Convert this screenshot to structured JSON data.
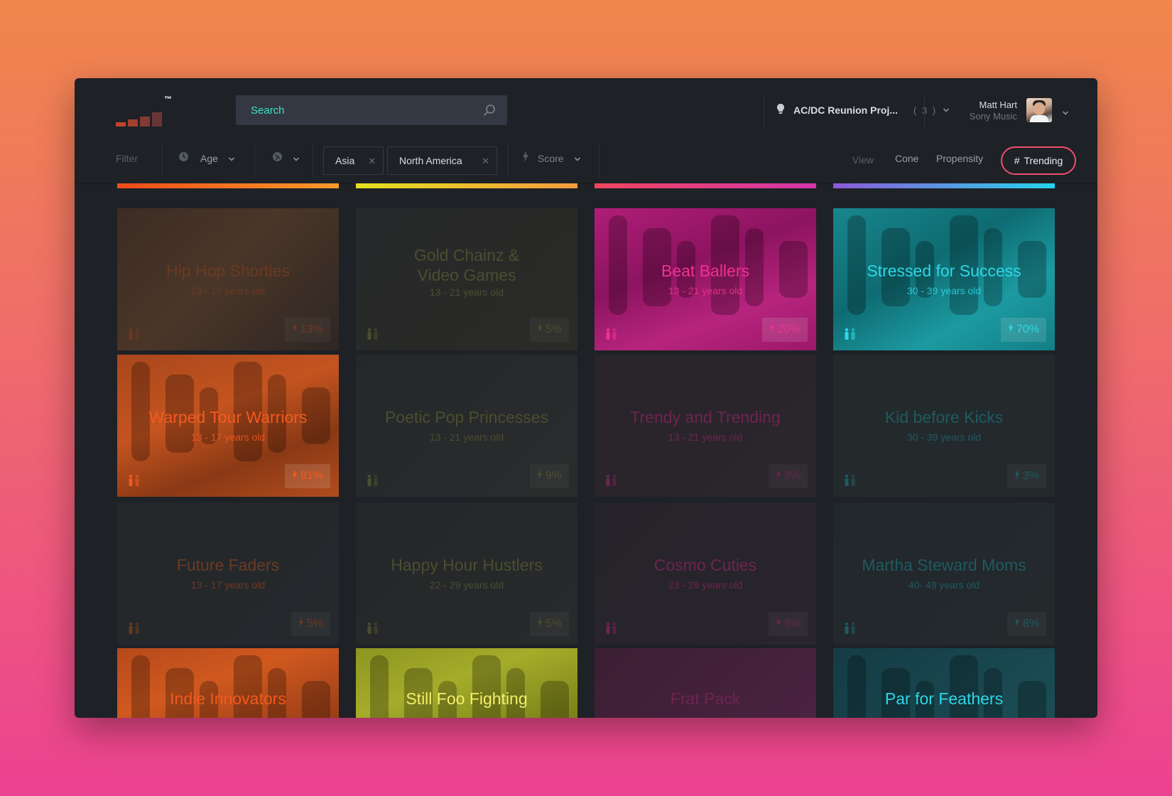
{
  "colors": {
    "orange": "#f25a1f",
    "olive": "#c2c73a",
    "magenta": "#f0318f",
    "cyan": "#2ed7e6",
    "accent_search": "#3fe0c5",
    "trending_ring": "#ef4d6f"
  },
  "header": {
    "search_placeholder": "Search",
    "project_name": "AC/DC Reunion Proj...",
    "project_count": "( 3 )",
    "user_name": "Matt Hart",
    "user_company": "Sony Music"
  },
  "filters": {
    "label": "Filter",
    "age_label": "Age",
    "chips": [
      "Asia",
      "North America"
    ],
    "score_label": "Score",
    "view_label": "View",
    "view_options": [
      "Cone",
      "Propensity"
    ],
    "active_view": "Trending"
  },
  "cards": [
    {
      "title": "Hip Hop Shorties",
      "age": "13 - 17 years old",
      "score": "13%"
    },
    {
      "title": "Gold Chainz & Video Games",
      "age": "13 - 21 years old",
      "score": "5%"
    },
    {
      "title": "Beat Ballers",
      "age": "13 - 21 years old",
      "score": "20%"
    },
    {
      "title": "Stressed for Success",
      "age": "30 - 39 years old",
      "score": "70%"
    },
    {
      "title": "Warped Tour Warriors",
      "age": "13 - 17 years old",
      "score": "81%"
    },
    {
      "title": "Poetic Pop Princesses",
      "age": "13 - 21 years old",
      "score": "9%"
    },
    {
      "title": "Trendy and Trending",
      "age": "13 - 21 years old",
      "score": "3%"
    },
    {
      "title": "Kid before Kicks",
      "age": "30 - 39 years old",
      "score": "3%"
    },
    {
      "title": "Future Faders",
      "age": "13 - 17 years old",
      "score": "5%"
    },
    {
      "title": "Happy Hour Hustlers",
      "age": "22 - 29 years old",
      "score": "5%"
    },
    {
      "title": "Cosmo Cuties",
      "age": "23 - 29 years old",
      "score": "8%"
    },
    {
      "title": "Martha Steward Moms",
      "age": "40- 49 years old",
      "score": "8%"
    },
    {
      "title": "Indie Innovators",
      "age": "",
      "score": ""
    },
    {
      "title": "Still Foo Fighting",
      "age": "",
      "score": ""
    },
    {
      "title": "Frat Pack",
      "age": "",
      "score": ""
    },
    {
      "title": "Par for Feathers",
      "age": "",
      "score": ""
    }
  ]
}
